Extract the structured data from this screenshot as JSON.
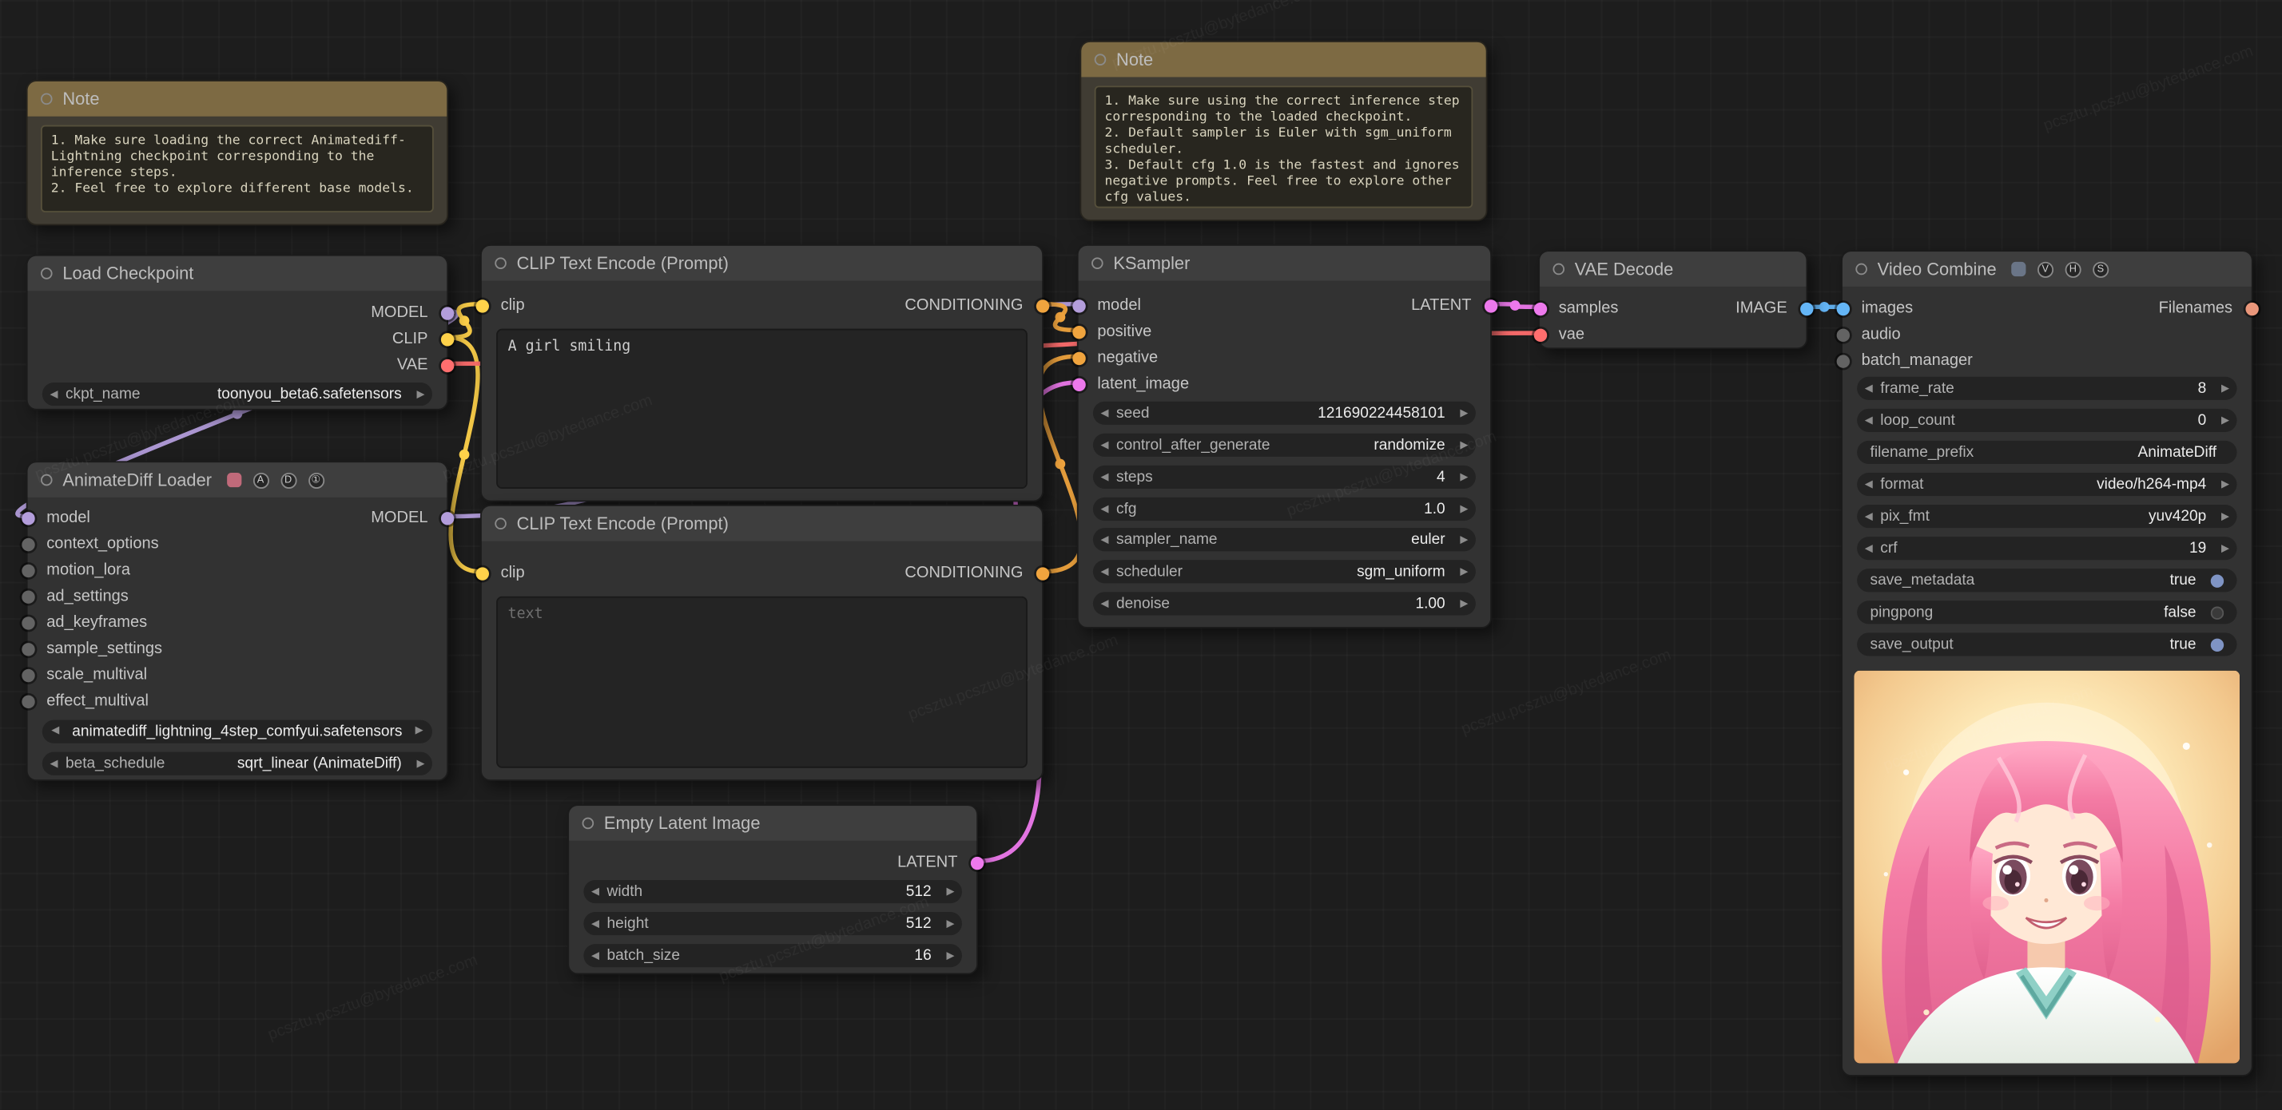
{
  "watermark": {
    "text": "pcsztu.pcsztu@bytedance.com"
  },
  "icons": {
    "arrow_left": "◀",
    "arrow_right": "▶"
  },
  "colors": {
    "model": "#b39ddb",
    "clip": "#ffd24a",
    "vae": "#ff6e6e",
    "conditioning": "#f0a43e",
    "latent": "#ed79ec",
    "image": "#64b5f6",
    "filenames": "#e9967a",
    "generic_slot": "#636363",
    "note_header": "#7d6a43",
    "node_header": "#3e3e3e",
    "node_body": "#323232",
    "canvas_bg": "#1d1d1d",
    "toggle_on": "#7f94c4"
  },
  "notes": [
    {
      "title": "Note",
      "text": "1. Make sure loading the correct Animatediff-\nLightning checkpoint corresponding to the\ninference steps.\n2. Feel free to explore different base models."
    },
    {
      "title": "Note",
      "text": "1. Make sure using the correct inference step\ncorresponding to the loaded checkpoint.\n2. Default sampler is Euler with sgm_uniform\nscheduler.\n3. Default cfg 1.0 is the fastest and ignores\nnegative prompts. Feel free to explore other\ncfg values."
    }
  ],
  "nodes": {
    "load_checkpoint": {
      "title": "Load Checkpoint",
      "outputs": [
        "MODEL",
        "CLIP",
        "VAE"
      ],
      "widgets": [
        {
          "label": "ckpt_name",
          "value": "toonyou_beta6.safetensors"
        }
      ]
    },
    "animatediff_loader": {
      "title": "AnimateDiff Loader",
      "badges": [
        "A",
        "D",
        "①"
      ],
      "inputs": [
        "model",
        "context_options",
        "motion_lora",
        "ad_settings",
        "ad_keyframes",
        "sample_settings",
        "scale_multival",
        "effect_multival"
      ],
      "outputs": [
        "MODEL"
      ],
      "widgets": [
        {
          "label": "",
          "value": "animatediff_lightning_4step_comfyui.safetensors"
        },
        {
          "label": "beta_schedule",
          "value": "sqrt_linear (AnimateDiff)"
        }
      ]
    },
    "clip_text_encode_positive": {
      "title": "CLIP Text Encode (Prompt)",
      "inputs": [
        "clip"
      ],
      "outputs": [
        "CONDITIONING"
      ],
      "prompt": "A girl smiling"
    },
    "clip_text_encode_negative": {
      "title": "CLIP Text Encode (Prompt)",
      "inputs": [
        "clip"
      ],
      "outputs": [
        "CONDITIONING"
      ],
      "prompt_placeholder": "text"
    },
    "empty_latent_image": {
      "title": "Empty Latent Image",
      "outputs": [
        "LATENT"
      ],
      "widgets": [
        {
          "label": "width",
          "value": "512"
        },
        {
          "label": "height",
          "value": "512"
        },
        {
          "label": "batch_size",
          "value": "16"
        }
      ]
    },
    "ksampler": {
      "title": "KSampler",
      "inputs": [
        "model",
        "positive",
        "negative",
        "latent_image"
      ],
      "outputs": [
        "LATENT"
      ],
      "widgets": [
        {
          "label": "seed",
          "value": "121690224458101"
        },
        {
          "label": "control_after_generate",
          "value": "randomize"
        },
        {
          "label": "steps",
          "value": "4"
        },
        {
          "label": "cfg",
          "value": "1.0"
        },
        {
          "label": "sampler_name",
          "value": "euler"
        },
        {
          "label": "scheduler",
          "value": "sgm_uniform"
        },
        {
          "label": "denoise",
          "value": "1.00"
        }
      ]
    },
    "vae_decode": {
      "title": "VAE Decode",
      "inputs": [
        "samples",
        "vae"
      ],
      "outputs": [
        "IMAGE"
      ]
    },
    "video_combine": {
      "title": "Video Combine",
      "badges": [
        "V",
        "H",
        "S"
      ],
      "inputs": [
        "images",
        "audio",
        "batch_manager"
      ],
      "outputs": [
        "Filenames"
      ],
      "widgets": [
        {
          "label": "frame_rate",
          "value": "8"
        },
        {
          "label": "loop_count",
          "value": "0"
        },
        {
          "label": "filename_prefix",
          "value": "AnimateDiff"
        },
        {
          "label": "format",
          "value": "video/h264-mp4"
        },
        {
          "label": "pix_fmt",
          "value": "yuv420p"
        },
        {
          "label": "crf",
          "value": "19"
        },
        {
          "label": "save_metadata",
          "value": "true"
        },
        {
          "label": "pingpong",
          "value": "false"
        },
        {
          "label": "save_output",
          "value": "true"
        }
      ]
    }
  }
}
